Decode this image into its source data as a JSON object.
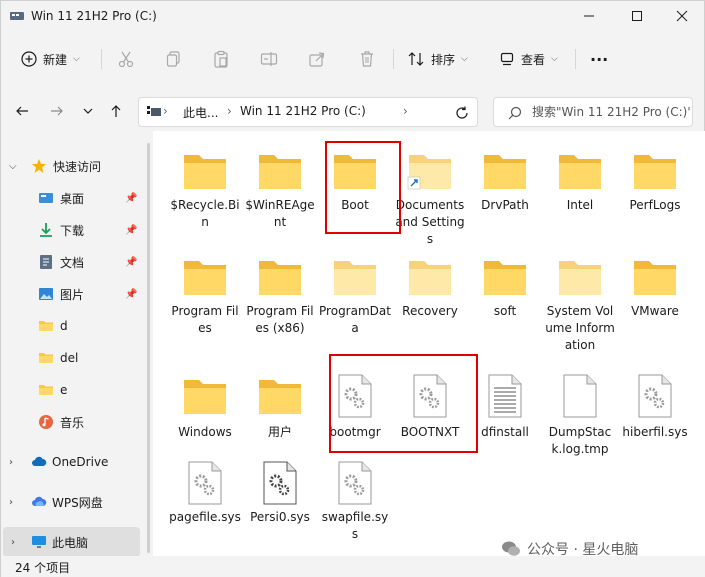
{
  "window": {
    "title": "Win 11 21H2 Pro (C:)",
    "controls": {
      "minimize": "minimize-icon",
      "maximize": "maximize-icon",
      "close": "close-icon"
    }
  },
  "toolbar": {
    "new_label": "新建",
    "sort_label": "排序",
    "view_label": "查看",
    "more_label": "···",
    "icons": [
      "cut-icon",
      "copy-icon",
      "paste-icon",
      "rename-icon",
      "share-icon",
      "delete-icon"
    ]
  },
  "address": {
    "crumbs": [
      "此电...",
      "Win 11 21H2 Pro (C:)"
    ],
    "search_placeholder": "搜索\"Win 11 21H2 Pro (C:)\""
  },
  "sidebar": {
    "quick_access": "快速访问",
    "items": [
      {
        "label": "桌面",
        "pinned": true
      },
      {
        "label": "下载",
        "pinned": true
      },
      {
        "label": "文档",
        "pinned": true
      },
      {
        "label": "图片",
        "pinned": true
      },
      {
        "label": "d",
        "pinned": false
      },
      {
        "label": "del",
        "pinned": false
      },
      {
        "label": "e",
        "pinned": false
      },
      {
        "label": "音乐",
        "pinned": false
      }
    ],
    "onedrive": "OneDrive",
    "wps": "WPS网盘",
    "thispc": "此电脑"
  },
  "files": [
    {
      "name": "$Recycle.Bin",
      "kind": "folder"
    },
    {
      "name": "$WinREAgent",
      "kind": "folder"
    },
    {
      "name": "Boot",
      "kind": "folder"
    },
    {
      "name": "Documents and Settings",
      "kind": "folder-link"
    },
    {
      "name": "DrvPath",
      "kind": "folder"
    },
    {
      "name": "Intel",
      "kind": "folder"
    },
    {
      "name": "PerfLogs",
      "kind": "folder"
    },
    {
      "name": "Program Files",
      "kind": "folder"
    },
    {
      "name": "Program Files (x86)",
      "kind": "folder"
    },
    {
      "name": "ProgramData",
      "kind": "folder-light"
    },
    {
      "name": "Recovery",
      "kind": "folder-light"
    },
    {
      "name": "soft",
      "kind": "folder"
    },
    {
      "name": "System Volume Information",
      "kind": "folder-light"
    },
    {
      "name": "VMware",
      "kind": "folder"
    },
    {
      "name": "Windows",
      "kind": "folder"
    },
    {
      "name": "用户",
      "kind": "folder"
    },
    {
      "name": "bootmgr",
      "kind": "sysfile"
    },
    {
      "name": "BOOTNXT",
      "kind": "sysfile"
    },
    {
      "name": "dfinstall",
      "kind": "textfile"
    },
    {
      "name": "DumpStack.log.tmp",
      "kind": "blankfile"
    },
    {
      "name": "hiberfil.sys",
      "kind": "sysfile"
    },
    {
      "name": "pagefile.sys",
      "kind": "sysfile"
    },
    {
      "name": "Persi0.sys",
      "kind": "sysfile-dark"
    },
    {
      "name": "swapfile.sys",
      "kind": "sysfile"
    }
  ],
  "status": {
    "count": "24 个项目"
  },
  "watermark": "公众号 · 星火电脑",
  "colors": {
    "highlight": "#e00000",
    "folder": "#f7c948",
    "accent": "#0067c0"
  }
}
